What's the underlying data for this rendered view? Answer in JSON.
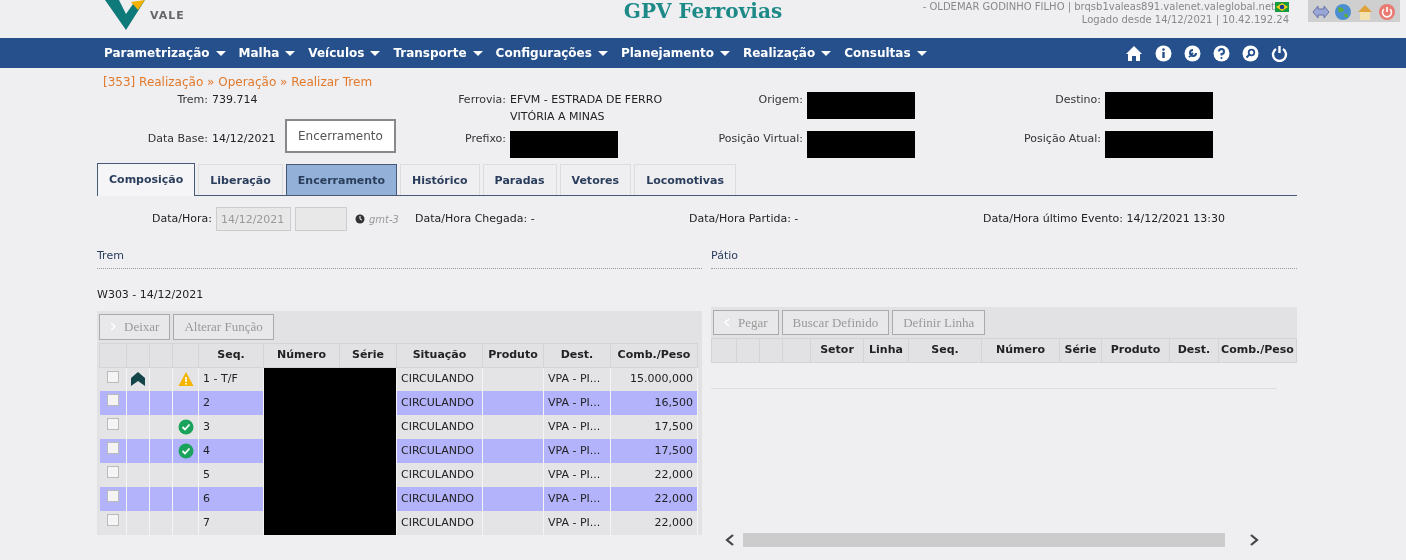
{
  "header": {
    "logo_text": "VALE",
    "title": "GPV Ferrovias",
    "user_line": "- OLDEMAR GODINHO FILHO | brqsb1valeas891.valenet.valeglobal.net",
    "login_line": "Logado desde 14/12/2021 | 10.42.192.24"
  },
  "menu": [
    "Parametrização",
    "Malha",
    "Veículos",
    "Transporte",
    "Configurações",
    "Planejamento",
    "Realização",
    "Consultas"
  ],
  "breadcrumb": "[353] Realização » Operação » Realizar Trem",
  "info": [
    {
      "label": "Trem:",
      "value": "739.714",
      "kind": "text"
    },
    {
      "label": "Ferrovia:",
      "value": "EFVM - ESTRADA DE FERRO VITÓRIA A MINAS",
      "kind": "text"
    },
    {
      "label": "Origem:",
      "kind": "redacted"
    },
    {
      "label": "Destino:",
      "kind": "redacted"
    },
    {
      "label": "Data Base:",
      "value": "14/12/2021",
      "kind": "text"
    },
    {
      "label": "Prefixo:",
      "kind": "redacted"
    },
    {
      "label": "Posição Virtual:",
      "kind": "redacted"
    },
    {
      "label": "Posição Atual:",
      "kind": "redacted"
    }
  ],
  "tooltip": "Encerramento",
  "tabs": [
    {
      "label": "Composição",
      "selected": true,
      "hovered": false
    },
    {
      "label": "Liberação",
      "selected": false,
      "hovered": false
    },
    {
      "label": "Encerramento",
      "selected": false,
      "hovered": true
    },
    {
      "label": "Histórico",
      "selected": false,
      "hovered": false
    },
    {
      "label": "Paradas",
      "selected": false,
      "hovered": false
    },
    {
      "label": "Vetores",
      "selected": false,
      "hovered": false
    },
    {
      "label": "Locomotivas",
      "selected": false,
      "hovered": false
    }
  ],
  "filters": {
    "date_label": "Data/Hora:",
    "date_value": "14/12/2021",
    "timezone": "gmt-3",
    "arrival": "Data/Hora Chegada: -",
    "departure": "Data/Hora Partida: -",
    "last_event": "Data/Hora último Evento: 14/12/2021 13:30"
  },
  "trem": {
    "title": "Trem",
    "train_label": "W303 - 14/12/2021",
    "buttons": [
      {
        "label": "Deixar",
        "disabled": true
      },
      {
        "label": "Alterar Função",
        "disabled": true
      }
    ],
    "columns": [
      "",
      "",
      "",
      "",
      "Seq.",
      "Número",
      "Série",
      "Situação",
      "Produto",
      "Dest.",
      "Comb./Peso"
    ],
    "rows": [
      {
        "checked": false,
        "locomotive": true,
        "warning": true,
        "validated": false,
        "seq": "1 - T/F",
        "situacao": "CIRCULANDO",
        "dest": "VPA - PI...",
        "peso": "15.000,000"
      },
      {
        "checked": false,
        "locomotive": false,
        "warning": false,
        "validated": false,
        "seq": "2",
        "situacao": "CIRCULANDO",
        "dest": "VPA - PI...",
        "peso": "16,500"
      },
      {
        "checked": false,
        "locomotive": false,
        "warning": false,
        "validated": true,
        "seq": "3",
        "situacao": "CIRCULANDO",
        "dest": "VPA - PI...",
        "peso": "17,500"
      },
      {
        "checked": false,
        "locomotive": false,
        "warning": false,
        "validated": true,
        "seq": "4",
        "situacao": "CIRCULANDO",
        "dest": "VPA - PI...",
        "peso": "17,500"
      },
      {
        "checked": false,
        "locomotive": false,
        "warning": false,
        "validated": false,
        "seq": "5",
        "situacao": "CIRCULANDO",
        "dest": "VPA - PI...",
        "peso": "22,000"
      },
      {
        "checked": false,
        "locomotive": false,
        "warning": false,
        "validated": false,
        "seq": "6",
        "situacao": "CIRCULANDO",
        "dest": "VPA - PI...",
        "peso": "22,000"
      },
      {
        "checked": false,
        "locomotive": false,
        "warning": false,
        "validated": false,
        "seq": "7",
        "situacao": "CIRCULANDO",
        "dest": "VPA - PI...",
        "peso": "22,000"
      }
    ]
  },
  "patio": {
    "title": "Pátio",
    "buttons": [
      {
        "label": "Pegar",
        "disabled": true
      },
      {
        "label": "Buscar Definido",
        "disabled": true
      },
      {
        "label": "Definir Linha",
        "disabled": true
      }
    ],
    "columns": [
      "",
      "",
      "",
      "",
      "Setor",
      "Linha",
      "Seq.",
      "Número",
      "Série",
      "Produto",
      "Dest.",
      "Comb./Peso"
    ]
  }
}
